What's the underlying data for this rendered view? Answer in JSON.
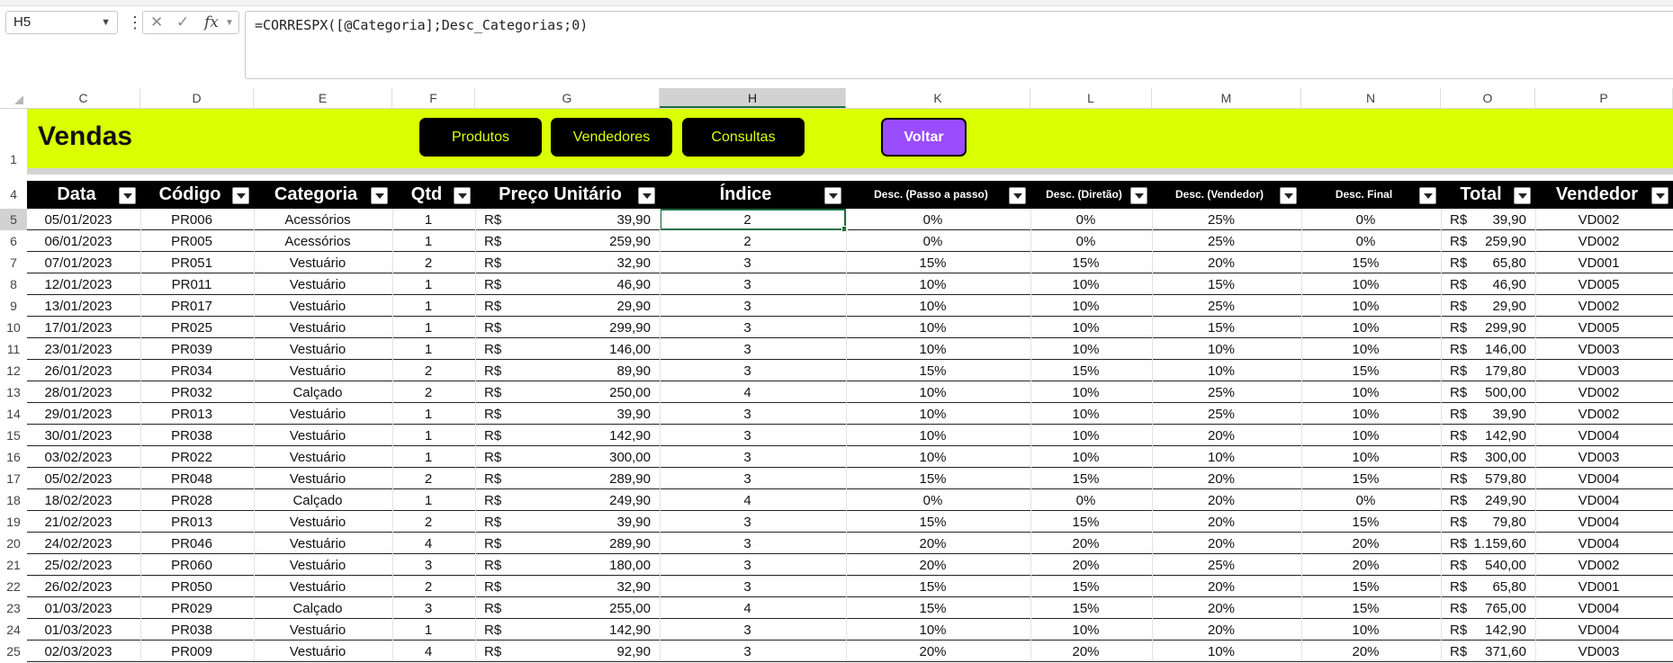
{
  "toolbar": {
    "name_box": "H5",
    "fx_label": "fx",
    "formula": "=CORRESPX([@Categoria];Desc_Categorias;0)"
  },
  "column_headers": [
    "C",
    "D",
    "E",
    "F",
    "G",
    "H",
    "K",
    "L",
    "M",
    "N",
    "O",
    "P"
  ],
  "row_numbers": [
    "1",
    "4",
    "5",
    "6",
    "7",
    "8",
    "9",
    "10",
    "11",
    "12",
    "13",
    "14",
    "15",
    "16",
    "17",
    "18",
    "19",
    "20",
    "21",
    "22",
    "23",
    "24",
    "25"
  ],
  "banner": {
    "title": "Vendas",
    "buttons": [
      "Produtos",
      "Vendedores",
      "Consultas"
    ],
    "back_button": "Voltar"
  },
  "colors": {
    "banner": "#daff00",
    "header": "#000000",
    "back_button": "#9a4cff"
  },
  "table": {
    "headers": [
      "Data",
      "Código",
      "Categoria",
      "Qtd",
      "Preço Unitário",
      "Índice",
      "Desc. (Passo a passo)",
      "Desc. (Diretão)",
      "Desc. (Vendedor)",
      "Desc. Final",
      "Total",
      "Vendedor"
    ],
    "currency": "R$",
    "rows": [
      [
        "05/01/2023",
        "PR006",
        "Acessórios",
        "1",
        "39,90",
        "2",
        "0%",
        "0%",
        "25%",
        "0%",
        "39,90",
        "VD002"
      ],
      [
        "06/01/2023",
        "PR005",
        "Acessórios",
        "1",
        "259,90",
        "2",
        "0%",
        "0%",
        "25%",
        "0%",
        "259,90",
        "VD002"
      ],
      [
        "07/01/2023",
        "PR051",
        "Vestuário",
        "2",
        "32,90",
        "3",
        "15%",
        "15%",
        "20%",
        "15%",
        "65,80",
        "VD001"
      ],
      [
        "12/01/2023",
        "PR011",
        "Vestuário",
        "1",
        "46,90",
        "3",
        "10%",
        "10%",
        "15%",
        "10%",
        "46,90",
        "VD005"
      ],
      [
        "13/01/2023",
        "PR017",
        "Vestuário",
        "1",
        "29,90",
        "3",
        "10%",
        "10%",
        "25%",
        "10%",
        "29,90",
        "VD002"
      ],
      [
        "17/01/2023",
        "PR025",
        "Vestuário",
        "1",
        "299,90",
        "3",
        "10%",
        "10%",
        "15%",
        "10%",
        "299,90",
        "VD005"
      ],
      [
        "23/01/2023",
        "PR039",
        "Vestuário",
        "1",
        "146,00",
        "3",
        "10%",
        "10%",
        "10%",
        "10%",
        "146,00",
        "VD003"
      ],
      [
        "26/01/2023",
        "PR034",
        "Vestuário",
        "2",
        "89,90",
        "3",
        "15%",
        "15%",
        "10%",
        "15%",
        "179,80",
        "VD003"
      ],
      [
        "28/01/2023",
        "PR032",
        "Calçado",
        "2",
        "250,00",
        "4",
        "10%",
        "10%",
        "25%",
        "10%",
        "500,00",
        "VD002"
      ],
      [
        "29/01/2023",
        "PR013",
        "Vestuário",
        "1",
        "39,90",
        "3",
        "10%",
        "10%",
        "25%",
        "10%",
        "39,90",
        "VD002"
      ],
      [
        "30/01/2023",
        "PR038",
        "Vestuário",
        "1",
        "142,90",
        "3",
        "10%",
        "10%",
        "20%",
        "10%",
        "142,90",
        "VD004"
      ],
      [
        "03/02/2023",
        "PR022",
        "Vestuário",
        "1",
        "300,00",
        "3",
        "10%",
        "10%",
        "10%",
        "10%",
        "300,00",
        "VD003"
      ],
      [
        "05/02/2023",
        "PR048",
        "Vestuário",
        "2",
        "289,90",
        "3",
        "15%",
        "15%",
        "20%",
        "15%",
        "579,80",
        "VD004"
      ],
      [
        "18/02/2023",
        "PR028",
        "Calçado",
        "1",
        "249,90",
        "4",
        "0%",
        "0%",
        "20%",
        "0%",
        "249,90",
        "VD004"
      ],
      [
        "21/02/2023",
        "PR013",
        "Vestuário",
        "2",
        "39,90",
        "3",
        "15%",
        "15%",
        "20%",
        "15%",
        "79,80",
        "VD004"
      ],
      [
        "24/02/2023",
        "PR046",
        "Vestuário",
        "4",
        "289,90",
        "3",
        "20%",
        "20%",
        "20%",
        "20%",
        "1.159,60",
        "VD004"
      ],
      [
        "25/02/2023",
        "PR060",
        "Vestuário",
        "3",
        "180,00",
        "3",
        "20%",
        "20%",
        "25%",
        "20%",
        "540,00",
        "VD002"
      ],
      [
        "26/02/2023",
        "PR050",
        "Vestuário",
        "2",
        "32,90",
        "3",
        "15%",
        "15%",
        "20%",
        "15%",
        "65,80",
        "VD001"
      ],
      [
        "01/03/2023",
        "PR029",
        "Calçado",
        "3",
        "255,00",
        "4",
        "15%",
        "15%",
        "20%",
        "15%",
        "765,00",
        "VD004"
      ],
      [
        "01/03/2023",
        "PR038",
        "Vestuário",
        "1",
        "142,90",
        "3",
        "10%",
        "10%",
        "20%",
        "10%",
        "142,90",
        "VD004"
      ],
      [
        "02/03/2023",
        "PR009",
        "Vestuário",
        "4",
        "92,90",
        "3",
        "20%",
        "20%",
        "10%",
        "20%",
        "371,60",
        "VD003"
      ]
    ]
  }
}
